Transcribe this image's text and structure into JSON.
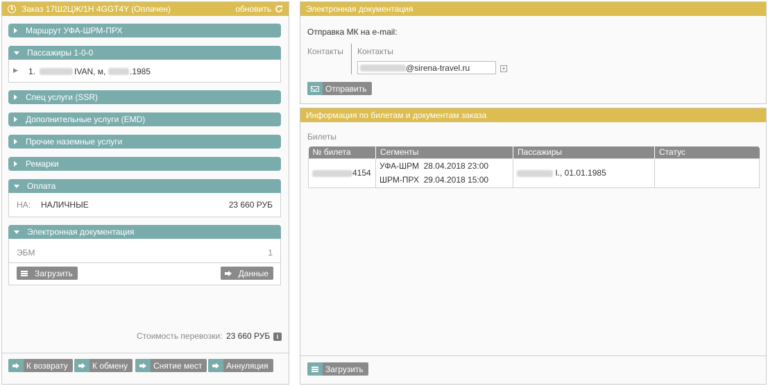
{
  "order": {
    "title": "Заказ 17Ш2ЦЖ/1Н 4GGT4Y (Оплачен)",
    "refresh": "обновить",
    "sections": {
      "route": "Маршрут  УФА-ШРМ-ПРХ",
      "passengers": "Пассажиры 1-0-0",
      "ssr": "Спец услуги (SSR)",
      "emd": "Дополнительные услуги (EMD)",
      "ground": "Прочие наземные услуги",
      "remarks": "Ремарки",
      "payment": "Оплата",
      "edoc": "Электронная документация"
    },
    "passenger": {
      "num": "1.",
      "name": "IVAN, м,",
      "year": ".1985"
    },
    "payment_row": {
      "code": "НА:",
      "type": "НАЛИЧНЫЕ",
      "amount": "23 660 РУБ"
    },
    "edoc_row": {
      "label": "ЭБМ",
      "count": "1"
    },
    "load_button": "Загрузить",
    "data_button": "Данные",
    "cost_label": "Стоимость перевозки:",
    "cost_value": "23 660 РУБ",
    "actions": {
      "refund": "К возврату",
      "exchange": "К обмену",
      "remove": "Снятие мест",
      "cancel": "Аннуляция"
    }
  },
  "edoc_panel": {
    "title": "Электронная документация",
    "email_label": "Отправка МК на e-mail:",
    "contacts_left": "Контакты",
    "contacts_right": "Контакты",
    "email_domain": "@sirena-travel.ru",
    "send_button": "Отправить"
  },
  "tickets_panel": {
    "title": "Информация по билетам и документам заказа",
    "subtitle": "Билеты",
    "headers": [
      "№ билета",
      "Сегменты",
      "Пассажиры",
      "Статус"
    ],
    "row": {
      "ticket_suffix": "4154",
      "seg1": "УФА-ШРМ  28.04.2018 23:00",
      "seg2": "ШРМ-ПРХ  29.04.2018 15:00",
      "passenger": "I., 01.01.1985",
      "status": ""
    },
    "load_button": "Загрузить"
  },
  "colors": {
    "gold": "#dcbd52",
    "teal": "#7aacac",
    "gray_btn": "#8a8a8a"
  }
}
